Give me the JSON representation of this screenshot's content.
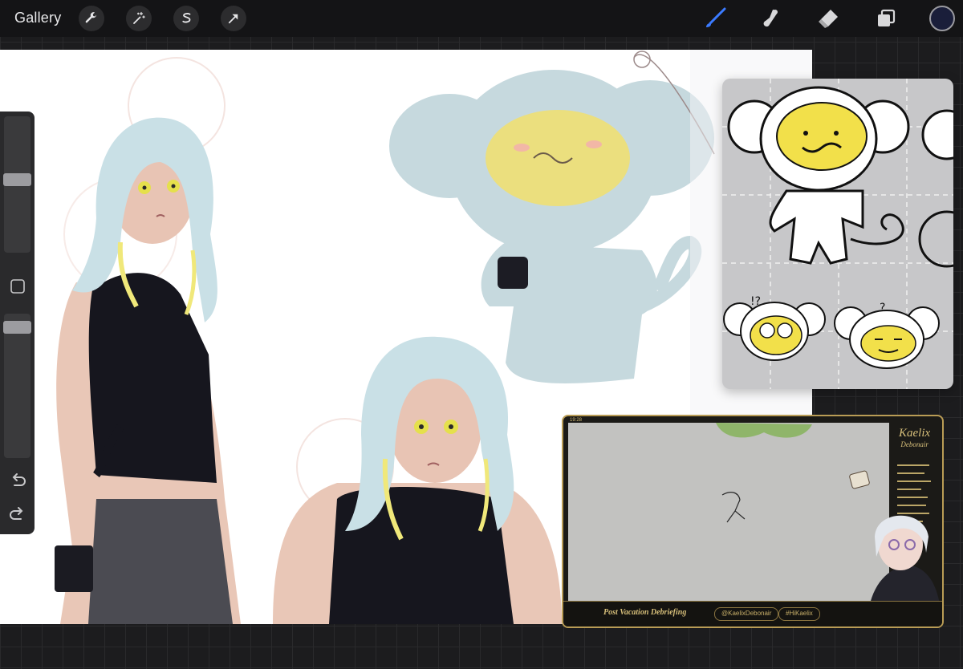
{
  "topbar": {
    "gallery_label": "Gallery",
    "left_tools": [
      "wrench-icon",
      "magic-wand-icon",
      "selection-icon",
      "transform-arrow-icon"
    ],
    "right_tools": [
      "brush-icon",
      "smudge-icon",
      "eraser-icon",
      "layers-icon"
    ],
    "active_color": "#1a1e3a",
    "accent_color": "#3b7bff"
  },
  "sidebar": {
    "brush_size_level": 0.45,
    "opacity_level": 0.95
  },
  "stream": {
    "timestamp": "19:28",
    "title": "Post Vacation Debriefing",
    "handle": "@KaelixDebonair",
    "hashtag": "#HiKaelix",
    "logo_line1": "Kaelix",
    "logo_line2": "Debonair"
  }
}
